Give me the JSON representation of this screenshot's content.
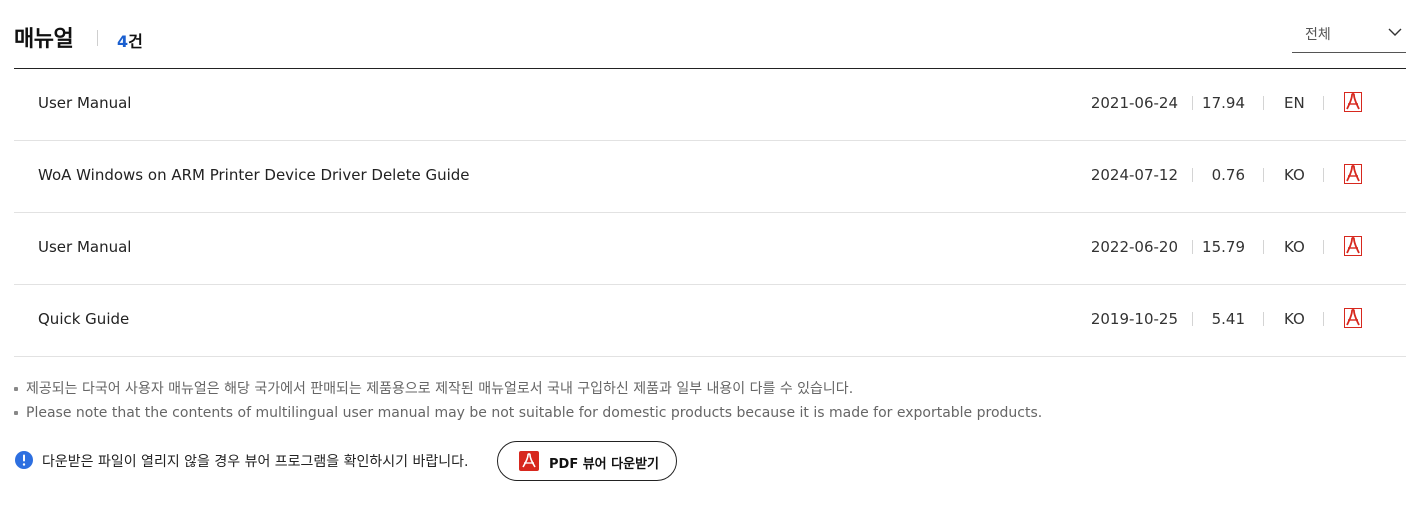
{
  "header": {
    "title": "매뉴얼",
    "count_number": "4",
    "count_suffix": "건",
    "filter_label": "전체"
  },
  "manuals": [
    {
      "name": "User Manual",
      "date": "2021-06-24",
      "size": "17.94",
      "lang": "EN"
    },
    {
      "name": "WoA Windows on ARM Printer Device Driver Delete Guide",
      "date": "2024-07-12",
      "size": "0.76",
      "lang": "KO"
    },
    {
      "name": "User Manual",
      "date": "2022-06-20",
      "size": "15.79",
      "lang": "KO"
    },
    {
      "name": "Quick Guide",
      "date": "2019-10-25",
      "size": "5.41",
      "lang": "KO"
    }
  ],
  "notes": [
    "제공되는 다국어 사용자 매뉴얼은 해당 국가에서 판매되는 제품용으로 제작된 매뉴얼로서 국내 구입하신 제품과 일부 내용이 다를 수 있습니다.",
    "Please note that the contents of multilingual user manual may be not suitable for domestic products because it is made for exportable products."
  ],
  "info": {
    "text": "다운받은 파일이 열리지 않을 경우 뷰어 프로그램을 확인하시기 바랍니다.",
    "button_label": "PDF 뷰어 다운받기"
  },
  "colors": {
    "accent": "#1a5fd0",
    "pdf_red": "#d7281e",
    "info_blue": "#2d6fe0"
  },
  "icons": {
    "row_file": "pdf-icon",
    "filter": "chevron-down-icon",
    "info": "info-icon",
    "button": "acrobat-icon"
  }
}
